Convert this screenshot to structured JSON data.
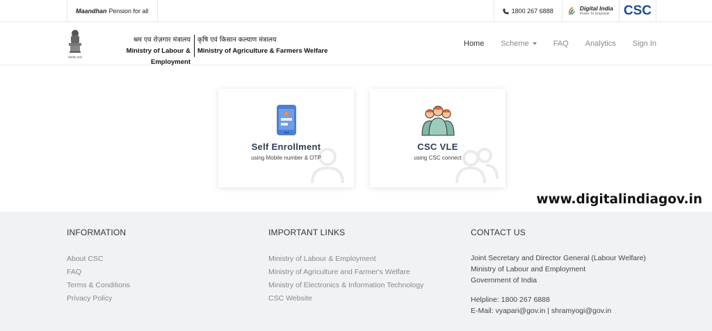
{
  "topbar": {
    "tagline_bold": "Maandhan",
    "tagline_rest": "Pension for all",
    "helpline": "1800 267 6888",
    "digital_india_title": "Digital India",
    "digital_india_sub": "Power To Empower",
    "csc_logo": "CSC"
  },
  "header": {
    "ministry1_hi": "श्रम एव रोज़गार मंत्रालय",
    "ministry1_en": "Ministry of Labour & Employment",
    "ministry2_hi": "कृषि एवं किसान कल्याण मंत्रालय",
    "ministry2_en": "Ministry of Agriculture & Farmers Welfare",
    "emblem_caption": "सत्यमेव जयते"
  },
  "nav": {
    "home": "Home",
    "scheme": "Scheme",
    "faq": "FAQ",
    "analytics": "Analytics",
    "signin": "Sign In"
  },
  "cards": [
    {
      "title": "Self Enrollment",
      "subtitle": "using Mobile number & OTP",
      "icon": "mobile-phone-icon"
    },
    {
      "title": "CSC VLE",
      "subtitle": "using CSC connect",
      "icon": "group-users-icon"
    }
  ],
  "footer": {
    "information": {
      "heading": "INFORMATION",
      "links": [
        "About CSC",
        "FAQ",
        "Terms & Conditions",
        "Privacy Policy"
      ]
    },
    "important_links": {
      "heading": "IMPORTANT LINKS",
      "links": [
        "Ministry of Labour & Employment",
        "Ministry of Agriculture and Farmer's Welfare",
        "Ministry of Electronics & Information Technology",
        "CSC Website"
      ]
    },
    "contact": {
      "heading": "CONTACT US",
      "address": [
        "Joint Secretary and Director General (Labour Welfare)",
        "Ministry of Labour and Employment",
        "Government of India"
      ],
      "helpline": "Helpline: 1800 267 6888",
      "email": "E-Mail: vyapari@gov.in | shramyogi@gov.in"
    }
  },
  "watermark": "www.digitalindiagov.in",
  "colors": {
    "footer_bg": "#f1f2f4",
    "csc_blue": "#1a4e9a",
    "card_title": "#2c3e50"
  }
}
